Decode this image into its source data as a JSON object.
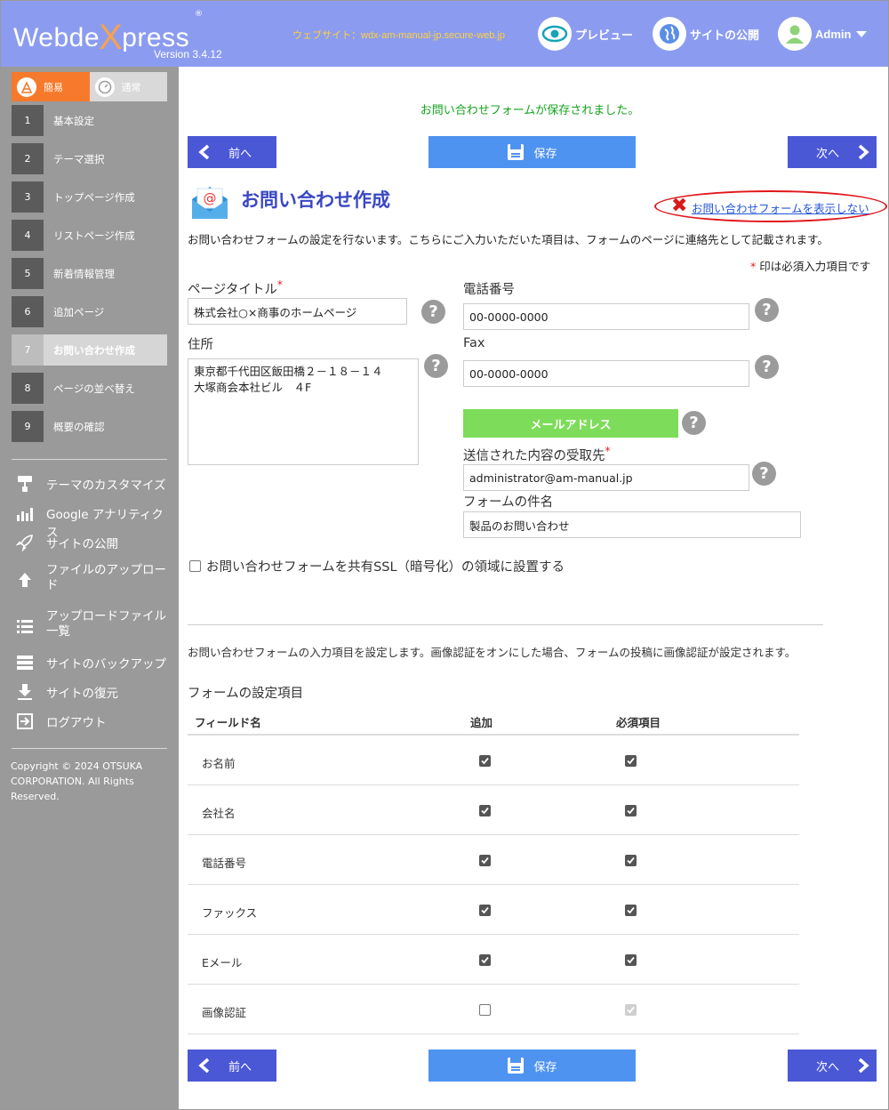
{
  "header": {
    "logo_pre": "Webde",
    "logo_x": "X",
    "logo_post": "press",
    "logo_reg": "®",
    "version": "Version 3.4.12",
    "site_label": "ウェブサイト：wdx-am-manual-jp.secure-web.jp",
    "preview": "プレビュー",
    "publish": "サイトの公開",
    "admin": "Admin"
  },
  "sidebar": {
    "mode_simple": "簡易",
    "mode_normal": "通常",
    "steps": [
      {
        "num": "1",
        "label": "基本設定"
      },
      {
        "num": "2",
        "label": "テーマ選択"
      },
      {
        "num": "3",
        "label": "トップページ作成"
      },
      {
        "num": "4",
        "label": "リストページ作成"
      },
      {
        "num": "5",
        "label": "新着情報管理"
      },
      {
        "num": "6",
        "label": "追加ページ"
      },
      {
        "num": "7",
        "label": "お問い合わせ作成"
      },
      {
        "num": "8",
        "label": "ページの並べ替え"
      },
      {
        "num": "9",
        "label": "概要の確認"
      }
    ],
    "tools": [
      {
        "label": "テーマのカスタマイズ"
      },
      {
        "label": "Google アナリティクス"
      },
      {
        "label": "サイトの公開"
      },
      {
        "label": "ファイルのアップロード"
      },
      {
        "label": "アップロードファイル一覧"
      },
      {
        "label": "サイトのバックアップ"
      },
      {
        "label": "サイトの復元"
      },
      {
        "label": "ログアウト"
      }
    ],
    "copyright": "Copyright © 2024 OTSUKA CORPORATION. All Rights Reserved."
  },
  "main": {
    "saved_message": "お問い合わせフォームが保存されました。",
    "prev": "前へ",
    "save": "保存",
    "next": "次へ",
    "title": "お問い合わせ作成",
    "hide_link": "お問い合わせフォームを表示しない",
    "intro": "お問い合わせフォームの設定を行ないます。こちらにご入力いただいた項目は、フォームのページに連絡先として記載されます。",
    "required_mark": "*",
    "required_note": " 印は必須入力項目です",
    "page_title_label": "ページタイトル",
    "page_title_value": "株式会社○×商事のホームページ",
    "address_label": "住所",
    "address_line1": "東京都千代田区飯田橋２－１８－１４",
    "address_line2": "大塚商会本社ビル　４F",
    "phone_label": "電話番号",
    "phone_value": "00-0000-0000",
    "fax_label": "Fax",
    "fax_value": "00-0000-0000",
    "mail_button": "メールアドレス",
    "recipient_label": "送信された内容の受取先",
    "recipient_value": "administrator@am-manual.jp",
    "subject_label": "フォームの件名",
    "subject_value": "製品のお問い合わせ",
    "ssl_label": "お問い合わせフォームを共有SSL（暗号化）の領域に設置する",
    "form_desc": "お問い合わせフォームの入力項目を設定します。画像認証をオンにした場合、フォームの投稿に画像認証が設定されます。",
    "form_heading": "フォームの設定項目",
    "help_mark": "?",
    "table": {
      "col_field": "フィールド名",
      "col_add": "追加",
      "col_required": "必須項目",
      "rows": [
        {
          "name": "お名前",
          "add": true,
          "required": true
        },
        {
          "name": "会社名",
          "add": true,
          "required": true
        },
        {
          "name": "電話番号",
          "add": true,
          "required": true
        },
        {
          "name": "ファックス",
          "add": true,
          "required": true
        },
        {
          "name": "Eメール",
          "add": true,
          "required": true
        },
        {
          "name": "画像認証",
          "add": false,
          "required": true
        }
      ]
    }
  }
}
